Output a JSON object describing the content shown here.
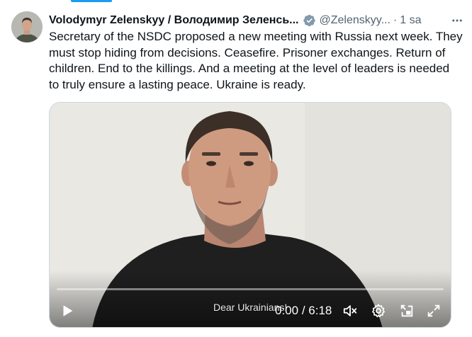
{
  "tweet": {
    "display_name": "Volodymyr Zelenskyy / Володимир Зеленсь...",
    "handle": "@Zelenskyy...",
    "separator": "·",
    "time": "1 sa",
    "text": "Secretary of the NSDC proposed a new meeting with Russia next week. They must stop hiding from decisions. Ceasefire. Prisoner exchanges. Return of children. End to the killings. And a meeting at the level of leaders is needed to truly ensure a lasting peace.  Ukraine is ready."
  },
  "video": {
    "subtitle": "Dear Ukrainians!",
    "current_time": "0:00",
    "duration": "6:18",
    "time_separator": " / ",
    "progress": 0,
    "muted": true
  },
  "icons": {
    "verified": "verified-badge-icon",
    "more": "more-options-icon",
    "play": "play-icon",
    "mute": "muted-speaker-icon",
    "settings": "gear-icon",
    "pip": "picture-in-picture-icon",
    "fullscreen": "fullscreen-icon"
  },
  "colors": {
    "accent": "#1d9bf0",
    "verified": "#829aab",
    "text_primary": "#0f1419",
    "text_secondary": "#536471"
  }
}
